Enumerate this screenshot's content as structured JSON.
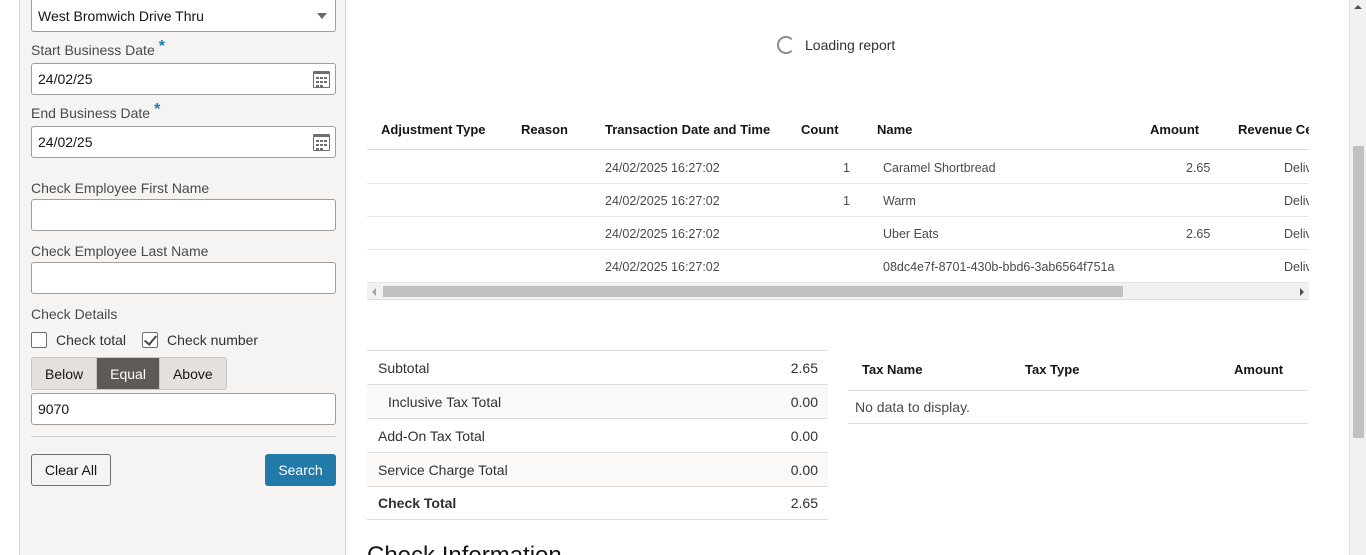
{
  "filters": {
    "location": "West Bromwich Drive Thru",
    "start_label": "Start Business Date",
    "start_value": "24/02/25",
    "end_label": "End Business Date",
    "end_value": "24/02/25",
    "required_mark": "*",
    "first_name_label": "Check Employee First Name",
    "first_name_value": "",
    "last_name_label": "Check Employee Last Name",
    "last_name_value": "",
    "check_details_label": "Check Details",
    "check_total_label": "Check total",
    "check_total_checked": false,
    "check_number_label": "Check number",
    "check_number_checked": true,
    "compare": {
      "below": "Below",
      "equal": "Equal",
      "above": "Above",
      "selected": "Equal"
    },
    "check_value": "9070",
    "clear_label": "Clear All",
    "search_label": "Search"
  },
  "report": {
    "loading_text": "Loading report",
    "columns": {
      "adjustment_type": "Adjustment Type",
      "reason": "Reason",
      "transaction_date": "Transaction Date and Time",
      "count": "Count",
      "name": "Name",
      "amount": "Amount",
      "revenue_center": "Revenue Cer"
    },
    "rows": [
      {
        "date": "24/02/2025 16:27:02",
        "count": "1",
        "name": "Caramel Shortbread",
        "amount": "2.65",
        "rvc": "Deliv"
      },
      {
        "date": "24/02/2025 16:27:02",
        "count": "1",
        "name": "Warm",
        "amount": "",
        "rvc": "Deliv"
      },
      {
        "date": "24/02/2025 16:27:02",
        "count": "",
        "name": "Uber Eats",
        "amount": "2.65",
        "rvc": "Deliv"
      },
      {
        "date": "24/02/2025 16:27:02",
        "count": "",
        "name": "08dc4e7f-8701-430b-bbd6-3ab6564f751a",
        "amount": "",
        "rvc": "Deliv"
      }
    ]
  },
  "totals": [
    {
      "label": "Subtotal",
      "value": "2.65"
    },
    {
      "label": "Inclusive Tax Total",
      "value": "0.00"
    },
    {
      "label": "Add-On Tax Total",
      "value": "0.00"
    },
    {
      "label": "Service Charge Total",
      "value": "0.00"
    },
    {
      "label": "Check Total",
      "value": "2.65"
    }
  ],
  "tax": {
    "col_name": "Tax Name",
    "col_type": "Tax Type",
    "col_amount": "Amount",
    "empty_text": "No data to display."
  },
  "section_title": "Check Information",
  "icons": {
    "calendar": "calendar-icon",
    "spinner": "loading-spinner-icon",
    "dropdown": "chevron-down-icon"
  },
  "colors": {
    "accent": "#227aa8",
    "segment_active": "#5e5a55",
    "panel_bg": "#f5f4f2"
  }
}
